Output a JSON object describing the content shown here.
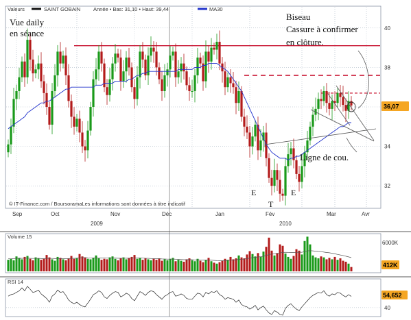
{
  "header": {
    "valeurs_label": "Valeurs",
    "series_label": "SAINT GOBAIN",
    "range_label": "Année • Bas: 31,10 • Haut: 39,44",
    "ma_label": "MA30"
  },
  "annotations": {
    "title_line1": "Vue daily",
    "title_line2": "en séance",
    "biseau": "Biseau",
    "cassure_line1": "Cassure à confirmer",
    "cassure_line2": "en clôture.",
    "ligne_de_cou": "Ligne de cou.",
    "e_left": "E",
    "t_label": "T",
    "e_right": "E"
  },
  "footer": {
    "source": "© IT-Finance.com / BoursoramaLes informations sont données à titre indicatif"
  },
  "colors": {
    "up": "#1a9a1a",
    "down": "#b31b1b",
    "ma": "#2233cc",
    "resistance": "#c8102e",
    "badge_price": "#f5a623",
    "badge_volume": "#f5a623",
    "badge_rsi": "#f5a623",
    "grid": "#9aa8b8"
  },
  "chart_data": [
    {
      "type": "candlestick",
      "title": "SAINT GOBAIN",
      "x_tick_labels": [
        "Sep",
        "Oct",
        "Nov",
        "Déc",
        "Jan",
        "Fév",
        "Mar",
        "Avr"
      ],
      "year_labels": [
        "2009",
        "2010"
      ],
      "y_tick_labels": [
        "32",
        "34",
        "36",
        "38",
        "40"
      ],
      "ylim": [
        31.0,
        41.0
      ],
      "last_price_label": "36,07",
      "last_price": 36.07,
      "resistance_levels": [
        39.1,
        37.6,
        36.7
      ],
      "series": [
        {
          "name": "SAINT GOBAIN",
          "close": [
            34.1,
            35.0,
            36.4,
            36.8,
            37.5,
            38.3,
            37.5,
            39.4,
            38.4,
            37.7,
            37.9,
            38.2,
            37.3,
            36.7,
            36.0,
            35.1,
            36.8,
            37.6,
            38.8,
            38.2,
            38.6,
            37.6,
            36.3,
            35.5,
            35.0,
            35.4,
            34.7,
            34.0,
            33.8,
            34.8,
            36.0,
            37.4,
            37.9,
            38.8,
            38.2,
            37.0,
            36.6,
            37.4,
            38.2,
            38.7,
            38.5,
            37.3,
            37.8,
            38.5,
            38.0,
            37.0,
            36.4,
            37.5,
            38.8,
            38.4,
            37.6,
            38.6,
            39.0,
            38.8,
            38.0,
            37.4,
            36.8,
            37.6,
            37.9,
            38.6,
            38.8,
            37.5,
            37.8,
            38.2,
            37.8,
            37.1,
            36.8,
            36.8,
            37.6,
            38.5,
            38.2,
            37.3,
            38.8,
            38.3,
            39.0,
            38.9,
            39.3,
            38.2,
            37.8,
            37.0,
            37.5,
            37.2,
            37.0,
            36.2,
            36.8,
            35.5,
            35.0,
            34.7,
            34.0,
            34.5,
            35.1,
            33.8,
            34.3,
            34.7,
            33.4,
            32.4,
            32.0,
            32.8,
            32.3,
            31.6,
            31.5,
            33.0,
            33.6,
            33.9,
            33.3,
            32.6,
            32.2,
            33.0,
            33.7,
            34.3,
            35.0,
            35.6,
            35.9,
            36.4,
            36.3,
            36.8,
            36.2,
            35.9,
            36.3,
            36.2,
            36.7,
            36.5,
            36.1,
            35.8,
            36.3,
            36.07
          ],
          "ma30": [
            34.9,
            35.0,
            35.1,
            35.2,
            35.3,
            35.4,
            35.5,
            35.7,
            35.8,
            35.9,
            36.0,
            36.1,
            36.2,
            36.2,
            36.3,
            36.3,
            36.4,
            36.5,
            36.6,
            36.7,
            36.8,
            36.9,
            36.9,
            37.0,
            37.0,
            37.0,
            37.0,
            37.0,
            37.0,
            37.0,
            37.0,
            37.0,
            37.1,
            37.1,
            37.1,
            37.2,
            37.2,
            37.2,
            37.2,
            37.3,
            37.3,
            37.3,
            37.3,
            37.3,
            37.4,
            37.4,
            37.5,
            37.6,
            37.6,
            37.7,
            37.7,
            37.8,
            37.8,
            37.8,
            37.8,
            37.8,
            37.8,
            37.8,
            37.8,
            37.8,
            37.8,
            37.8,
            37.9,
            37.9,
            37.9,
            37.9,
            37.9,
            37.9,
            38.0,
            38.0,
            38.0,
            38.1,
            38.1,
            38.2,
            38.2,
            38.2,
            38.2,
            38.1,
            38.0,
            37.9,
            37.8,
            37.6,
            37.4,
            37.2,
            37.0,
            36.8,
            36.5,
            36.2,
            35.9,
            35.6,
            35.3,
            35.0,
            34.7,
            34.4,
            34.1,
            33.9,
            33.7,
            33.6,
            33.5,
            33.4,
            33.4,
            33.4,
            33.3,
            33.4,
            33.4,
            33.5,
            33.5,
            33.6,
            33.7,
            33.8,
            33.9,
            34.0,
            34.1,
            34.2,
            34.3,
            34.4,
            34.5,
            34.6,
            34.7,
            34.8,
            34.9,
            35.0,
            35.0,
            35.1,
            35.2,
            35.2
          ]
        }
      ]
    },
    {
      "type": "bar",
      "title": "Volume 15",
      "y_tick_labels": [
        "6000K"
      ],
      "last_value_label": "412K",
      "series": [
        {
          "name": "Volume 15",
          "unit": "K",
          "values": [
            2400,
            2600,
            2300,
            3100,
            2800,
            2500,
            3000,
            3200,
            2600,
            2300,
            2900,
            2700,
            2400,
            2600,
            3400,
            2900,
            2500,
            2200,
            3000,
            2800,
            2500,
            2300,
            2700,
            3200,
            2600,
            2800,
            3600,
            3100,
            2900,
            2600,
            2500,
            2800,
            3300,
            2700,
            2400,
            2600,
            2500,
            2900,
            3100,
            2600,
            2300,
            2700,
            2900,
            2500,
            2800,
            3000,
            3400,
            2600,
            2800,
            2400,
            2700,
            2500,
            2300,
            2600,
            2400,
            2700,
            2200,
            2500,
            2300,
            2600,
            2800,
            2100,
            2400,
            2200,
            2000,
            2500,
            2700,
            2300,
            2100,
            2600,
            2200,
            1900,
            2400,
            2800,
            2100,
            1800,
            1600,
            1900,
            2200,
            2600,
            2400,
            3000,
            2500,
            2700,
            3300,
            2900,
            2700,
            3500,
            4200,
            3600,
            3100,
            3800,
            3000,
            4100,
            5100,
            7000,
            4300,
            3300,
            3800,
            5600,
            5300,
            3700,
            3000,
            2600,
            3200,
            4600,
            4300,
            3500,
            6300,
            7200,
            5600,
            3300,
            2900,
            2700,
            3100,
            2900,
            2500,
            2800,
            2500,
            3000,
            2400,
            2700,
            2200,
            2000,
            1600,
            900
          ],
          "ma": [
            2600,
            2600,
            2650,
            2700,
            2720,
            2700,
            2720,
            2750,
            2700,
            2680,
            2700,
            2700,
            2650,
            2650,
            2700,
            2700,
            2680,
            2650,
            2650,
            2650,
            2650,
            2620,
            2650,
            2700,
            2700,
            2720,
            2800,
            2850,
            2850,
            2820,
            2800,
            2800,
            2820,
            2800,
            2780,
            2760,
            2740,
            2750,
            2780,
            2760,
            2720,
            2720,
            2740,
            2720,
            2720,
            2740,
            2800,
            2780,
            2780,
            2740,
            2720,
            2700,
            2660,
            2640,
            2620,
            2620,
            2580,
            2560,
            2540,
            2540,
            2560,
            2520,
            2500,
            2460,
            2420,
            2420,
            2440,
            2420,
            2380,
            2400,
            2380,
            2340,
            2340,
            2360,
            2330,
            2280,
            2220,
            2200,
            2200,
            2240,
            2260,
            2320,
            2360,
            2400,
            2480,
            2520,
            2560,
            2640,
            2760,
            2840,
            2900,
            3000,
            3040,
            3140,
            3280,
            3500,
            3580,
            3620,
            3680,
            3820,
            3940,
            3960,
            3940,
            3900,
            3900,
            3950,
            3980,
            3950,
            4100,
            4250,
            4300,
            4250,
            4180,
            4120,
            4080,
            4000,
            3920,
            3850,
            3750,
            3650,
            3520,
            3400,
            3300,
            3150,
            3000,
            2850
          ]
        }
      ]
    },
    {
      "type": "line",
      "title": "RSI 14",
      "y_tick_labels": [
        "40"
      ],
      "last_value_label": "54,652",
      "ylim": [
        30,
        75
      ],
      "series": [
        {
          "name": "RSI 14",
          "values": [
            55,
            57,
            58,
            60,
            62,
            66,
            62,
            68,
            64,
            60,
            61,
            63,
            58,
            55,
            52,
            47,
            55,
            58,
            63,
            60,
            61,
            56,
            50,
            47,
            45,
            47,
            44,
            42,
            41,
            46,
            51,
            57,
            59,
            62,
            60,
            54,
            52,
            56,
            59,
            61,
            60,
            54,
            56,
            59,
            57,
            52,
            49,
            55,
            61,
            59,
            56,
            60,
            62,
            61,
            57,
            54,
            51,
            55,
            57,
            60,
            61,
            55,
            56,
            58,
            56,
            52,
            51,
            51,
            55,
            59,
            58,
            54,
            60,
            58,
            61,
            60,
            62,
            57,
            55,
            51,
            53,
            52,
            51,
            47,
            50,
            44,
            42,
            41,
            38,
            40,
            43,
            37,
            40,
            42,
            37,
            33,
            31,
            36,
            34,
            31,
            30,
            39,
            43,
            45,
            41,
            38,
            36,
            41,
            45,
            49,
            53,
            56,
            58,
            60,
            59,
            62,
            57,
            55,
            58,
            57,
            60,
            59,
            56,
            54,
            57,
            54.652
          ]
        }
      ]
    }
  ]
}
